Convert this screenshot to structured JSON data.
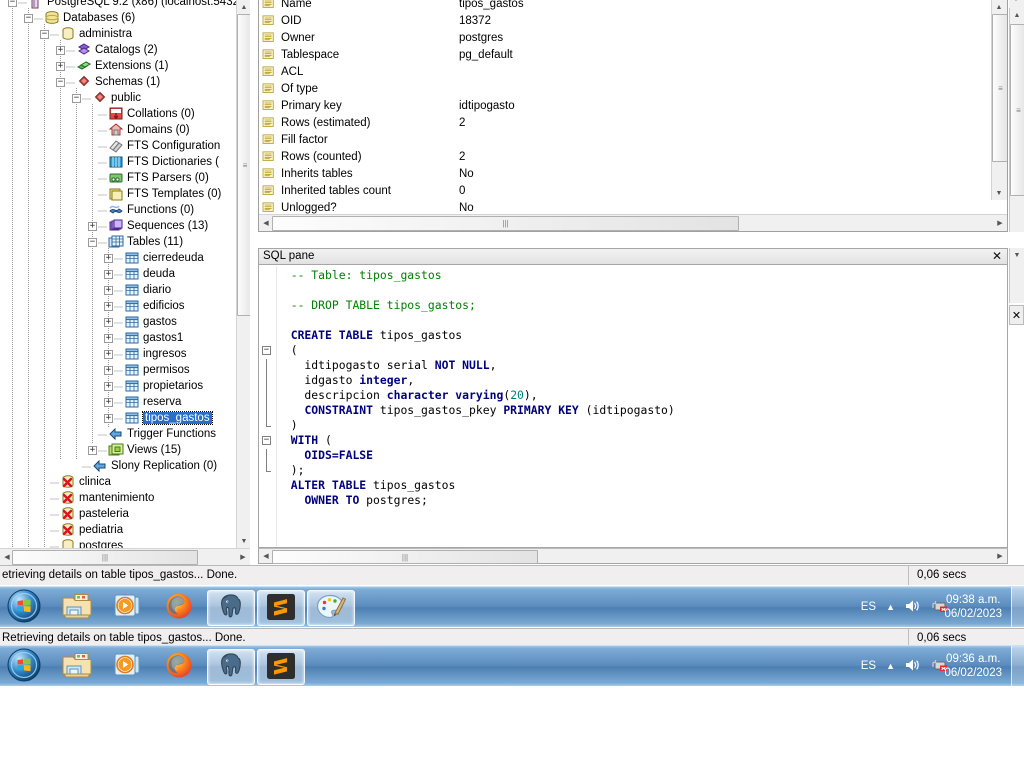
{
  "app": {
    "status_text": "Retrieving details on table tipos_gastos... Done.",
    "status_text_clipped": "etrieving details on table tipos_gastos... Done.",
    "status_secs": "0,06 secs"
  },
  "tree": {
    "nodes": [
      {
        "label": "PostgreSQL 9.2 (x86) (localhost:5432",
        "depth": 0,
        "expander": "minus",
        "icon": "server-icon"
      },
      {
        "label": "Databases (6)",
        "depth": 1,
        "expander": "minus",
        "icon": "databases-icon"
      },
      {
        "label": "administra",
        "depth": 2,
        "expander": "minus",
        "icon": "database-icon"
      },
      {
        "label": "Catalogs (2)",
        "depth": 3,
        "expander": "plus",
        "icon": "catalogs-icon"
      },
      {
        "label": "Extensions (1)",
        "depth": 3,
        "expander": "plus",
        "icon": "extensions-icon"
      },
      {
        "label": "Schemas (1)",
        "depth": 3,
        "expander": "minus",
        "icon": "schemas-icon"
      },
      {
        "label": "public",
        "depth": 4,
        "expander": "minus",
        "icon": "schema-icon"
      },
      {
        "label": "Collations (0)",
        "depth": 5,
        "expander": "none",
        "icon": "collations-icon"
      },
      {
        "label": "Domains (0)",
        "depth": 5,
        "expander": "none",
        "icon": "domains-icon"
      },
      {
        "label": "FTS Configuration",
        "depth": 5,
        "expander": "none",
        "icon": "fts-configuration-icon"
      },
      {
        "label": "FTS Dictionaries (",
        "depth": 5,
        "expander": "none",
        "icon": "fts-dictionaries-icon"
      },
      {
        "label": "FTS Parsers (0)",
        "depth": 5,
        "expander": "none",
        "icon": "fts-parsers-icon"
      },
      {
        "label": "FTS Templates (0)",
        "depth": 5,
        "expander": "none",
        "icon": "fts-templates-icon"
      },
      {
        "label": "Functions (0)",
        "depth": 5,
        "expander": "none",
        "icon": "functions-icon"
      },
      {
        "label": "Sequences (13)",
        "depth": 5,
        "expander": "plus",
        "icon": "sequences-icon"
      },
      {
        "label": "Tables (11)",
        "depth": 5,
        "expander": "minus",
        "icon": "tables-icon"
      },
      {
        "label": "cierredeuda",
        "depth": 6,
        "expander": "plus",
        "icon": "table-icon"
      },
      {
        "label": "deuda",
        "depth": 6,
        "expander": "plus",
        "icon": "table-icon"
      },
      {
        "label": "diario",
        "depth": 6,
        "expander": "plus",
        "icon": "table-icon"
      },
      {
        "label": "edificios",
        "depth": 6,
        "expander": "plus",
        "icon": "table-icon"
      },
      {
        "label": "gastos",
        "depth": 6,
        "expander": "plus",
        "icon": "table-icon"
      },
      {
        "label": "gastos1",
        "depth": 6,
        "expander": "plus",
        "icon": "table-icon"
      },
      {
        "label": "ingresos",
        "depth": 6,
        "expander": "plus",
        "icon": "table-icon"
      },
      {
        "label": "permisos",
        "depth": 6,
        "expander": "plus",
        "icon": "table-icon"
      },
      {
        "label": "propietarios",
        "depth": 6,
        "expander": "plus",
        "icon": "table-icon"
      },
      {
        "label": "reserva",
        "depth": 6,
        "expander": "plus",
        "icon": "table-icon"
      },
      {
        "label": "tipos_gastos",
        "depth": 6,
        "expander": "plus",
        "icon": "table-icon",
        "selected": true
      },
      {
        "label": "Trigger Functions",
        "depth": 5,
        "expander": "none",
        "icon": "trigger-functions-icon"
      },
      {
        "label": "Views (15)",
        "depth": 5,
        "expander": "plus",
        "icon": "views-icon"
      },
      {
        "label": "Slony Replication (0)",
        "depth": 4,
        "expander": "none",
        "icon": "slony-replication-icon"
      },
      {
        "label": "clinica",
        "depth": 2,
        "expander": "none",
        "icon": "database-disconnected-icon"
      },
      {
        "label": "mantenimiento",
        "depth": 2,
        "expander": "none",
        "icon": "database-disconnected-icon"
      },
      {
        "label": "pasteleria",
        "depth": 2,
        "expander": "none",
        "icon": "database-disconnected-icon"
      },
      {
        "label": "pediatria",
        "depth": 2,
        "expander": "none",
        "icon": "database-disconnected-icon"
      },
      {
        "label": "postgres",
        "depth": 2,
        "expander": "none",
        "icon": "database-icon"
      }
    ]
  },
  "properties": {
    "rows": [
      {
        "name": "Name",
        "value": "tipos_gastos"
      },
      {
        "name": "OID",
        "value": "18372"
      },
      {
        "name": "Owner",
        "value": "postgres"
      },
      {
        "name": "Tablespace",
        "value": "pg_default"
      },
      {
        "name": "ACL",
        "value": ""
      },
      {
        "name": "Of type",
        "value": ""
      },
      {
        "name": "Primary key",
        "value": "idtipogasto"
      },
      {
        "name": "Rows (estimated)",
        "value": "2"
      },
      {
        "name": "Fill factor",
        "value": ""
      },
      {
        "name": "Rows (counted)",
        "value": "2"
      },
      {
        "name": "Inherits tables",
        "value": "No"
      },
      {
        "name": "Inherited tables count",
        "value": "0"
      },
      {
        "name": "Unlogged?",
        "value": "No"
      }
    ]
  },
  "sql_pane": {
    "title": "SQL pane",
    "close_label": "✕",
    "lines": [
      {
        "indent": 2,
        "tokens": [
          {
            "t": "-- Table: tipos_gastos",
            "c": "cm"
          }
        ]
      },
      {
        "indent": 2,
        "tokens": []
      },
      {
        "indent": 2,
        "tokens": [
          {
            "t": "-- DROP TABLE tipos_gastos;",
            "c": "cm"
          }
        ]
      },
      {
        "indent": 2,
        "tokens": []
      },
      {
        "indent": 2,
        "tokens": [
          {
            "t": "CREATE TABLE",
            "c": "kw"
          },
          {
            "t": " tipos_gastos",
            "c": "pl"
          }
        ]
      },
      {
        "indent": 2,
        "fold": "minus",
        "tokens": [
          {
            "t": "(",
            "c": "pl"
          }
        ]
      },
      {
        "indent": 4,
        "bar": true,
        "tokens": [
          {
            "t": "  idtipogasto serial ",
            "c": "pl"
          },
          {
            "t": "NOT NULL",
            "c": "kw"
          },
          {
            "t": ",",
            "c": "pl"
          }
        ]
      },
      {
        "indent": 4,
        "bar": true,
        "tokens": [
          {
            "t": "  idgasto ",
            "c": "pl"
          },
          {
            "t": "integer",
            "c": "kw"
          },
          {
            "t": ",",
            "c": "pl"
          }
        ]
      },
      {
        "indent": 4,
        "bar": true,
        "tokens": [
          {
            "t": "  descripcion ",
            "c": "pl"
          },
          {
            "t": "character varying",
            "c": "kw"
          },
          {
            "t": "(",
            "c": "pl"
          },
          {
            "t": "20",
            "c": "num"
          },
          {
            "t": "),",
            "c": "pl"
          }
        ]
      },
      {
        "indent": 4,
        "bar": true,
        "tokens": [
          {
            "t": "  ",
            "c": "pl"
          },
          {
            "t": "CONSTRAINT",
            "c": "kw"
          },
          {
            "t": " tipos_gastos_pkey ",
            "c": "pl"
          },
          {
            "t": "PRIMARY KEY",
            "c": "kw"
          },
          {
            "t": " (idtipogasto)",
            "c": "pl"
          }
        ]
      },
      {
        "indent": 2,
        "barend": true,
        "tokens": [
          {
            "t": ")",
            "c": "pl"
          }
        ]
      },
      {
        "indent": 2,
        "fold": "minus",
        "tokens": [
          {
            "t": "WITH",
            "c": "kw"
          },
          {
            "t": " (",
            "c": "pl"
          }
        ]
      },
      {
        "indent": 4,
        "bar": true,
        "tokens": [
          {
            "t": "  OIDS=FALSE",
            "c": "kw"
          }
        ]
      },
      {
        "indent": 2,
        "barend": true,
        "tokens": [
          {
            "t": ");",
            "c": "pl"
          }
        ]
      },
      {
        "indent": 2,
        "tokens": [
          {
            "t": "ALTER TABLE",
            "c": "kw"
          },
          {
            "t": " tipos_gastos",
            "c": "pl"
          }
        ]
      },
      {
        "indent": 2,
        "tokens": [
          {
            "t": "  ",
            "c": "pl"
          },
          {
            "t": "OWNER TO",
            "c": "kw"
          },
          {
            "t": " postgres;",
            "c": "pl"
          }
        ]
      }
    ]
  },
  "taskbar_top": {
    "items": [
      {
        "name": "start-button",
        "icon": "windows-start-icon",
        "active": false
      },
      {
        "name": "explorer",
        "icon": "file-explorer-icon",
        "active": false
      },
      {
        "name": "media-player",
        "icon": "media-player-icon",
        "active": false
      },
      {
        "name": "firefox",
        "icon": "firefox-icon",
        "active": false
      },
      {
        "name": "pgadmin",
        "icon": "postgresql-elephant-icon",
        "active": true
      },
      {
        "name": "sublime-text",
        "icon": "sublime-text-icon",
        "active": true
      },
      {
        "name": "paint",
        "icon": "paint-palette-icon",
        "active": true
      }
    ],
    "lang": "ES",
    "time": "09:38 a.m.",
    "date": "06/02/2023"
  },
  "taskbar_bottom": {
    "items": [
      {
        "name": "start-button",
        "icon": "windows-start-icon",
        "active": false
      },
      {
        "name": "explorer",
        "icon": "file-explorer-icon",
        "active": false
      },
      {
        "name": "media-player",
        "icon": "media-player-icon",
        "active": false
      },
      {
        "name": "firefox",
        "icon": "firefox-icon",
        "active": false
      },
      {
        "name": "pgadmin",
        "icon": "postgresql-elephant-icon",
        "active": true
      },
      {
        "name": "sublime-text",
        "icon": "sublime-text-icon",
        "active": true
      }
    ],
    "lang": "ES",
    "time": "09:36 a.m.",
    "date": "06/02/2023"
  },
  "colors": {
    "selection_blue": "#2a6ec8",
    "keyword": "#00007f",
    "comment": "#007f00",
    "number": "#007f7f",
    "taskbar": "#5b8cbe",
    "statusbar": "#f0eeee"
  }
}
